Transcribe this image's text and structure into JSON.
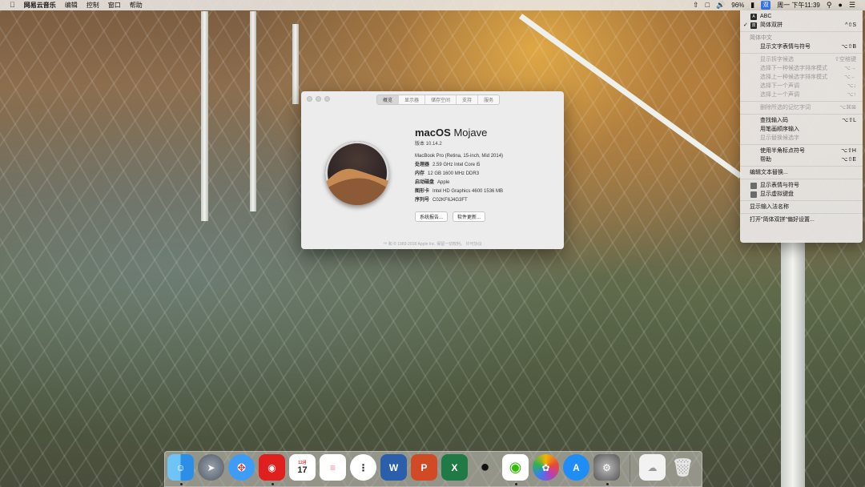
{
  "menubar": {
    "app_name": "网易云音乐",
    "menus": [
      "编辑",
      "控制",
      "窗口",
      "帮助"
    ],
    "battery": "96%",
    "ime_short": "双",
    "clock": "周一 下午11:39"
  },
  "about_window": {
    "tabs": [
      "概览",
      "显示器",
      "储存空间",
      "支持",
      "服务"
    ],
    "os_name_bold": "macOS",
    "os_name_light": "Mojave",
    "version": "版本 10.14.2",
    "model": "MacBook Pro (Retina, 15-inch, Mid 2014)",
    "specs": [
      {
        "key": "处理器",
        "value": "2.59 GHz Intel Core i5"
      },
      {
        "key": "内存",
        "value": "12 GB 1600 MHz DDR3"
      },
      {
        "key": "启动磁盘",
        "value": "Apple"
      },
      {
        "key": "图形卡",
        "value": "Intel HD Graphics 4600 1536 MB"
      },
      {
        "key": "序列号",
        "value": "C02KF6J4G3FT"
      }
    ],
    "buttons": [
      "系统报告...",
      "软件更新..."
    ],
    "footer": "™ 和 © 1983-2018 Apple Inc. 保留一切权利。   许可协议"
  },
  "ime_menu": {
    "sources": [
      {
        "badge": "A",
        "label": "ABC",
        "shortcut": "",
        "checked": false
      },
      {
        "badge": "双",
        "label": "简体双拼",
        "shortcut": "^⇧S",
        "checked": true
      }
    ],
    "section_header": "简体中文",
    "items_a": [
      {
        "label": "显示文字表情与符号",
        "shortcut": "⌥⇧B",
        "disabled": false
      },
      {
        "label": "显示拆字候选",
        "shortcut": "⇧空格键",
        "disabled": true
      },
      {
        "label": "选择下一种候选字排序模式",
        "shortcut": "⌥→",
        "disabled": true
      },
      {
        "label": "选择上一种候选字排序模式",
        "shortcut": "⌥←",
        "disabled": true
      },
      {
        "label": "选择下一个声调",
        "shortcut": "⌥↓",
        "disabled": true
      },
      {
        "label": "选择上一个声调",
        "shortcut": "⌥↑",
        "disabled": true
      }
    ],
    "items_b": [
      {
        "label": "删除所选的记忆字词",
        "shortcut": "⌥⌘⊠",
        "disabled": true
      }
    ],
    "items_c": [
      {
        "label": "查找输入码",
        "shortcut": "⌥⇧L",
        "disabled": false
      },
      {
        "label": "用笔画顺序输入",
        "shortcut": "",
        "disabled": false
      },
      {
        "label": "显示替换候选字",
        "shortcut": "",
        "disabled": true
      }
    ],
    "items_d": [
      {
        "label": "使用半角标点符号",
        "shortcut": "⌥⇧H",
        "disabled": false
      },
      {
        "label": "帮助",
        "shortcut": "⌥⇧E",
        "disabled": false
      }
    ],
    "edit_text": "编辑文本替换...",
    "show_emoji": "显示表情与符号",
    "show_keyboard": "显示虚拟键盘",
    "show_ime_name": "显示输入法名称",
    "open_prefs": "打开\"简体双拼\"偏好设置..."
  },
  "dock": {
    "calendar_month": "12月",
    "calendar_day": "17"
  }
}
